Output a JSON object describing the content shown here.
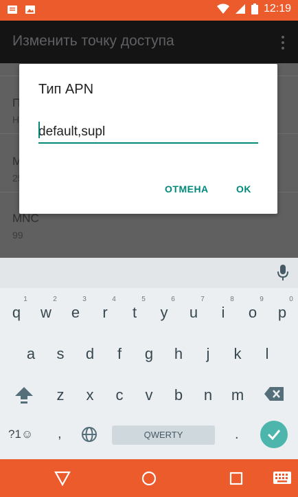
{
  "status_bar": {
    "time": "12:19"
  },
  "app_bar": {
    "title": "Изменить точку доступа"
  },
  "list": {
    "items": [
      {
        "title": "П",
        "subtitle": "Н"
      },
      {
        "title": "M",
        "subtitle": "25"
      },
      {
        "title": "MNC",
        "subtitle": "99"
      }
    ]
  },
  "dialog": {
    "title": "Тип APN",
    "input_value": "default,supl",
    "cancel_label": "ОТМЕНА",
    "ok_label": "OK"
  },
  "keyboard": {
    "row1": [
      {
        "key": "q",
        "hint": "1"
      },
      {
        "key": "w",
        "hint": "2"
      },
      {
        "key": "e",
        "hint": "3"
      },
      {
        "key": "r",
        "hint": "4"
      },
      {
        "key": "t",
        "hint": "5"
      },
      {
        "key": "y",
        "hint": "6"
      },
      {
        "key": "u",
        "hint": "7"
      },
      {
        "key": "i",
        "hint": "8"
      },
      {
        "key": "o",
        "hint": "9"
      },
      {
        "key": "p",
        "hint": "0"
      }
    ],
    "row2": [
      "a",
      "s",
      "d",
      "f",
      "g",
      "h",
      "j",
      "k",
      "l"
    ],
    "row3": [
      "z",
      "x",
      "c",
      "v",
      "b",
      "n",
      "m"
    ],
    "symbols_label": "?1☺",
    "comma": ",",
    "period": ".",
    "space_label": "QWERTY"
  }
}
